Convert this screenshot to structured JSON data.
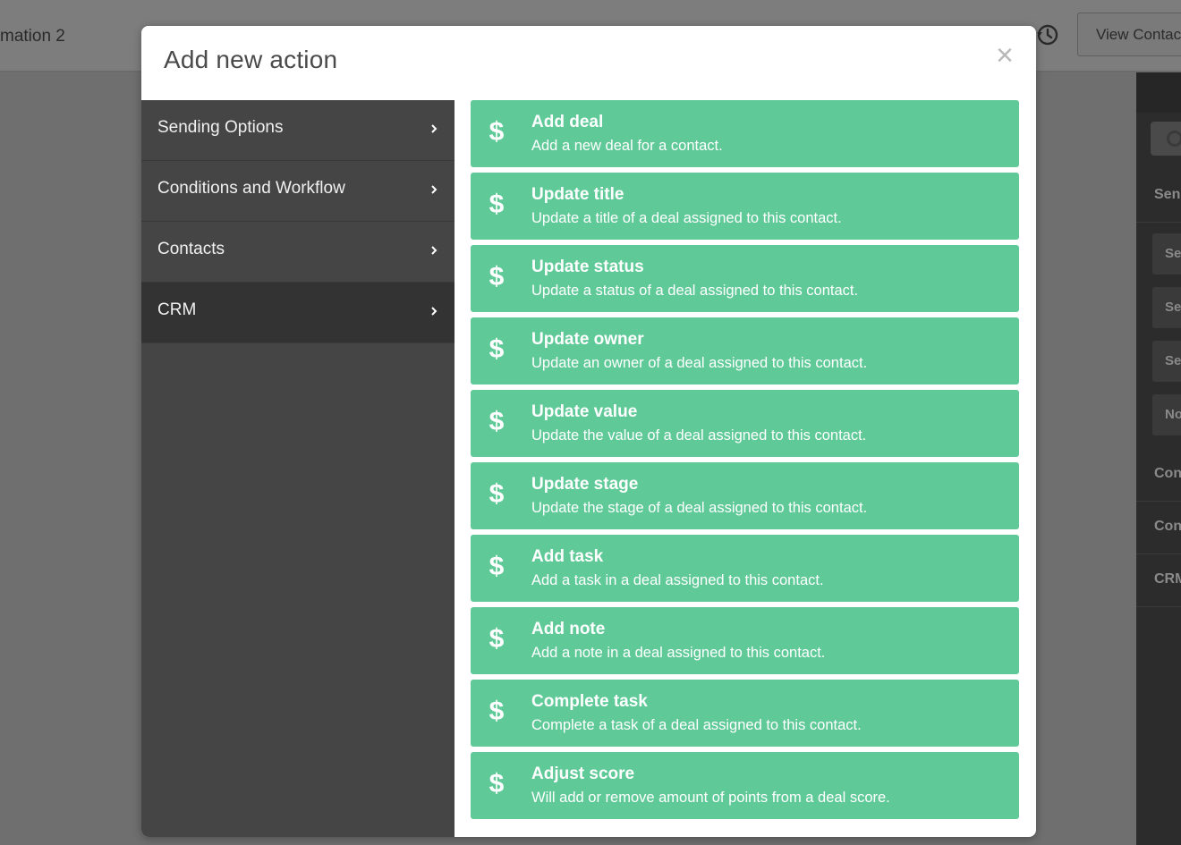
{
  "background": {
    "app_title": "mation 2",
    "view_button_label": "View Contac",
    "right_panel": {
      "sections": [
        "Senc",
        "Con",
        "Con",
        "CRM"
      ],
      "sub_items": [
        "Se",
        "Se",
        "Se",
        "No"
      ]
    }
  },
  "modal": {
    "title": "Add new action",
    "close_label": "×",
    "menu": [
      {
        "label": "Sending Options",
        "active": false
      },
      {
        "label": "Conditions and Workflow",
        "active": false
      },
      {
        "label": "Contacts",
        "active": false
      },
      {
        "label": "CRM",
        "active": true
      }
    ],
    "actions": [
      {
        "icon": "dollar-icon",
        "glyph": "$",
        "title": "Add deal",
        "description": "Add a new deal for a contact."
      },
      {
        "icon": "dollar-icon",
        "glyph": "$",
        "title": "Update title",
        "description": "Update a title of a deal assigned to this contact."
      },
      {
        "icon": "dollar-icon",
        "glyph": "$",
        "title": "Update status",
        "description": "Update a status of a deal assigned to this contact."
      },
      {
        "icon": "dollar-icon",
        "glyph": "$",
        "title": "Update owner",
        "description": "Update an owner of a deal assigned to this contact."
      },
      {
        "icon": "dollar-icon",
        "glyph": "$",
        "title": "Update value",
        "description": "Update the value of a deal assigned to this contact."
      },
      {
        "icon": "dollar-icon",
        "glyph": "$",
        "title": "Update stage",
        "description": "Update the stage of a deal assigned to this contact."
      },
      {
        "icon": "dollar-icon",
        "glyph": "$",
        "title": "Add task",
        "description": "Add a task in a deal assigned to this contact."
      },
      {
        "icon": "dollar-icon",
        "glyph": "$",
        "title": "Add note",
        "description": "Add a note in a deal assigned to this contact."
      },
      {
        "icon": "dollar-icon",
        "glyph": "$",
        "title": "Complete task",
        "description": "Complete a task of a deal assigned to this contact."
      },
      {
        "icon": "dollar-icon",
        "glyph": "$",
        "title": "Adjust score",
        "description": "Will add or remove amount of points from a deal score."
      }
    ]
  },
  "colors": {
    "action_green": "#5fca98",
    "menu_bg": "#454545",
    "menu_active_bg": "#333333"
  }
}
